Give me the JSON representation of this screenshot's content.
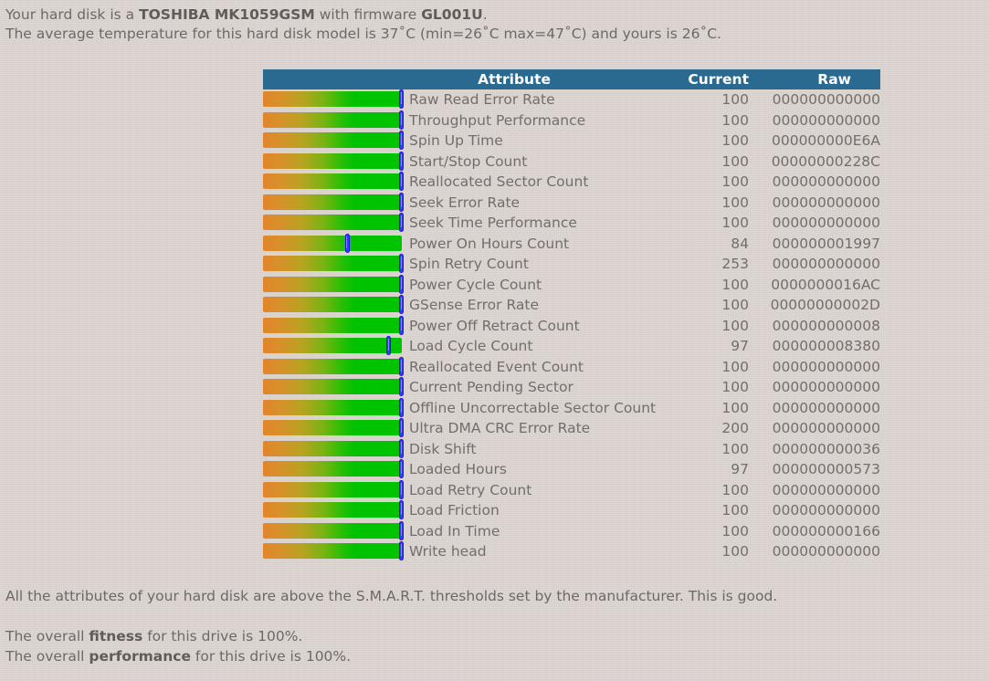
{
  "header": {
    "intro_line1_pre": "Your hard disk is a ",
    "intro_line1_model": "TOSHIBA MK1059GSM",
    "intro_line1_mid": " with firmware ",
    "intro_line1_firmware": "GL001U",
    "intro_line1_post": ".",
    "intro_line2": "The average temperature for this hard disk model is 37˚C (min=26˚C max=47˚C) and yours is 26˚C.",
    "model": "TOSHIBA MK1059GSM",
    "firmware": "GL001U",
    "avg_temp": "37˚C",
    "min_temp": "26˚C",
    "max_temp": "47˚C",
    "current_temp": "26˚C"
  },
  "table": {
    "columns": {
      "bar": "",
      "attribute": "Attribute",
      "current": "Current",
      "raw": "Raw"
    },
    "header_bg": "#2a6a91",
    "bar_gradient_from": "#e2852b",
    "bar_gradient_to": "#00c400",
    "marker_color": "#3a3af0",
    "rows": [
      {
        "attribute": "Raw Read Error Rate",
        "current": "100",
        "raw": "000000000000",
        "bar_pct": 100
      },
      {
        "attribute": "Throughput Performance",
        "current": "100",
        "raw": "000000000000",
        "bar_pct": 100
      },
      {
        "attribute": "Spin Up Time",
        "current": "100",
        "raw": "000000000E6A",
        "bar_pct": 100
      },
      {
        "attribute": "Start/Stop Count",
        "current": "100",
        "raw": "00000000228C",
        "bar_pct": 100
      },
      {
        "attribute": "Reallocated Sector Count",
        "current": "100",
        "raw": "000000000000",
        "bar_pct": 100
      },
      {
        "attribute": "Seek Error Rate",
        "current": "100",
        "raw": "000000000000",
        "bar_pct": 100
      },
      {
        "attribute": "Seek Time Performance",
        "current": "100",
        "raw": "000000000000",
        "bar_pct": 100
      },
      {
        "attribute": "Power On Hours Count",
        "current": "84",
        "raw": "000000001997",
        "bar_pct": 61
      },
      {
        "attribute": "Spin Retry Count",
        "current": "253",
        "raw": "000000000000",
        "bar_pct": 100
      },
      {
        "attribute": "Power Cycle Count",
        "current": "100",
        "raw": "0000000016AC",
        "bar_pct": 100
      },
      {
        "attribute": "GSense Error Rate",
        "current": "100",
        "raw": "00000000002D",
        "bar_pct": 100
      },
      {
        "attribute": "Power Off Retract Count",
        "current": "100",
        "raw": "000000000008",
        "bar_pct": 100
      },
      {
        "attribute": "Load Cycle Count",
        "current": "97",
        "raw": "000000008380",
        "bar_pct": 91
      },
      {
        "attribute": "Reallocated Event Count",
        "current": "100",
        "raw": "000000000000",
        "bar_pct": 100
      },
      {
        "attribute": "Current Pending Sector",
        "current": "100",
        "raw": "000000000000",
        "bar_pct": 100
      },
      {
        "attribute": "Offline Uncorrectable Sector Count",
        "current": "100",
        "raw": "000000000000",
        "bar_pct": 100
      },
      {
        "attribute": "Ultra DMA CRC Error Rate",
        "current": "200",
        "raw": "000000000000",
        "bar_pct": 100
      },
      {
        "attribute": "Disk Shift",
        "current": "100",
        "raw": "000000000036",
        "bar_pct": 100
      },
      {
        "attribute": "Loaded Hours",
        "current": "97",
        "raw": "000000000573",
        "bar_pct": 100
      },
      {
        "attribute": "Load Retry Count",
        "current": "100",
        "raw": "000000000000",
        "bar_pct": 100
      },
      {
        "attribute": "Load Friction",
        "current": "100",
        "raw": "000000000000",
        "bar_pct": 100
      },
      {
        "attribute": "Load In Time",
        "current": "100",
        "raw": "000000000166",
        "bar_pct": 100
      },
      {
        "attribute": "Write head",
        "current": "100",
        "raw": "000000000000",
        "bar_pct": 100
      }
    ]
  },
  "footer": {
    "summary": "All the attributes of your hard disk are above the S.M.A.R.T. thresholds set by the manufacturer. This is good.",
    "fitness_pre": "The overall ",
    "fitness_label": "fitness",
    "fitness_post": " for this drive is 100%.",
    "performance_pre": "The overall ",
    "performance_label": "performance",
    "performance_post": " for this drive is 100%.",
    "fitness_value": "100%",
    "performance_value": "100%"
  }
}
